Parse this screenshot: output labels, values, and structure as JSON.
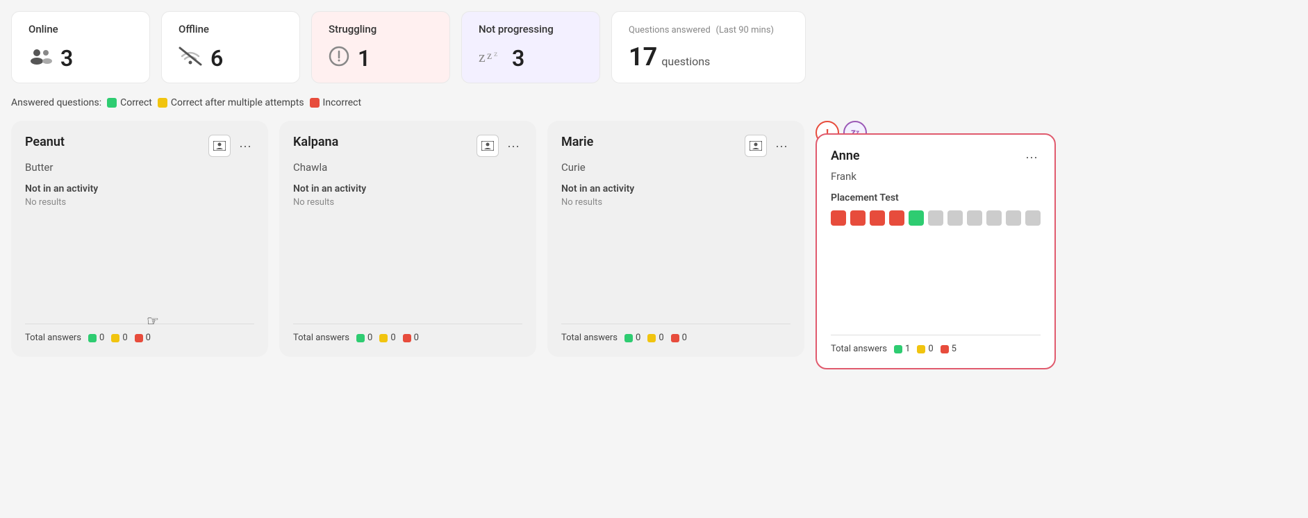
{
  "stats": {
    "online": {
      "label": "Online",
      "count": "3",
      "bg": "white"
    },
    "offline": {
      "label": "Offline",
      "count": "6",
      "bg": "white"
    },
    "struggling": {
      "label": "Struggling",
      "count": "1",
      "bg": "pink"
    },
    "not_progressing": {
      "label": "Not progressing",
      "count": "3",
      "bg": "purple"
    },
    "questions_answered": {
      "label": "Questions answered",
      "subtitle": "(Last 90 mins)",
      "count": "17",
      "unit": "questions"
    }
  },
  "legend": {
    "prefix": "Answered questions:",
    "correct": "Correct",
    "multi": "Correct after multiple attempts",
    "incorrect": "Incorrect"
  },
  "students": [
    {
      "id": "peanut",
      "first_name": "Peanut",
      "last_name": "Butter",
      "activity": "Not in an activity",
      "results": "No results",
      "total_correct": "0",
      "total_multi": "0",
      "total_incorrect": "0",
      "highlighted": false
    },
    {
      "id": "kalpana",
      "first_name": "Kalpana",
      "last_name": "Chawla",
      "activity": "Not in an activity",
      "results": "No results",
      "total_correct": "0",
      "total_multi": "0",
      "total_incorrect": "0",
      "highlighted": false
    },
    {
      "id": "marie",
      "first_name": "Marie",
      "last_name": "Curie",
      "activity": "Not in an activity",
      "results": "No results",
      "total_correct": "0",
      "total_multi": "0",
      "total_incorrect": "0",
      "highlighted": false
    },
    {
      "id": "anne",
      "first_name": "Anne",
      "last_name": "Frank",
      "activity": "Placement Test",
      "total_correct": "1",
      "total_multi": "0",
      "total_incorrect": "5",
      "highlighted": true,
      "answer_dots": [
        "red",
        "red",
        "red",
        "red",
        "green",
        "grey",
        "grey",
        "grey",
        "grey",
        "grey",
        "grey"
      ]
    }
  ],
  "card_labels": {
    "not_in_activity": "Not in an activity",
    "no_results": "No results",
    "total_answers": "Total answers",
    "placement_test": "Placement Test"
  },
  "menu_label": "···"
}
